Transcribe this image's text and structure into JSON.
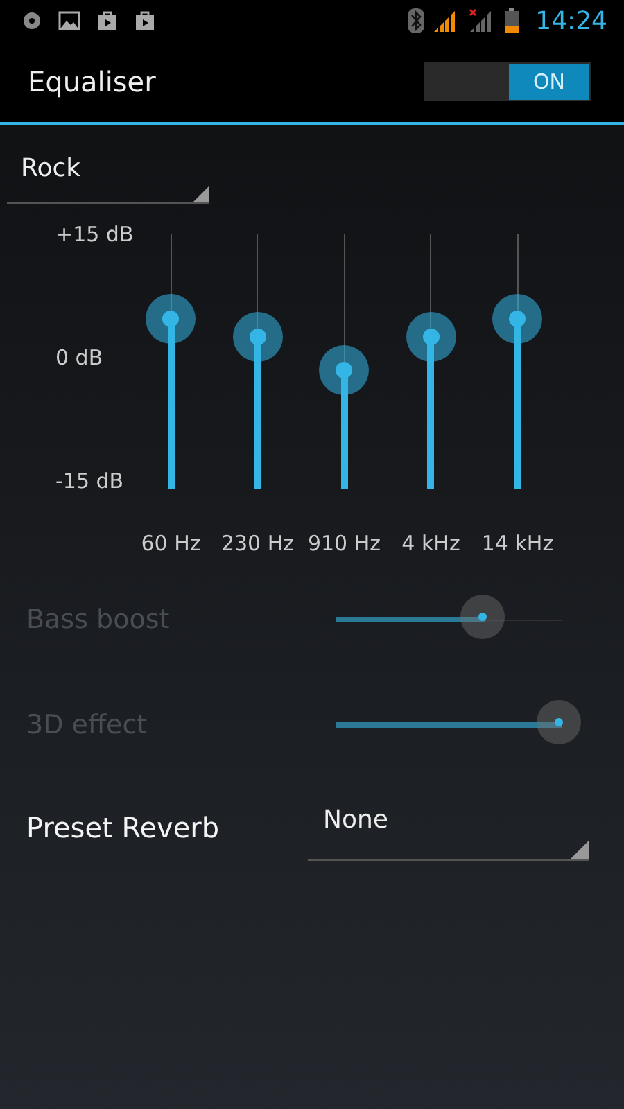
{
  "status_bar": {
    "time": "14:24"
  },
  "action_bar": {
    "title": "Equaliser",
    "switch": {
      "label": "ON",
      "on": true
    }
  },
  "preset": {
    "value": "Rock"
  },
  "equalizer": {
    "scale": [
      "+15 dB",
      "0 dB",
      "-15 dB"
    ],
    "bands": [
      {
        "label": "60 Hz",
        "level": 0.67
      },
      {
        "label": "230 Hz",
        "level": 0.6
      },
      {
        "label": "910 Hz",
        "level": 0.47
      },
      {
        "label": "4 kHz",
        "level": 0.6
      },
      {
        "label": "14 kHz",
        "level": 0.67
      }
    ]
  },
  "effects": [
    {
      "label": "Bass boost",
      "disabled": true,
      "level": 0.66
    },
    {
      "label": "3D effect",
      "disabled": true,
      "level": 1.0
    }
  ],
  "reverb": {
    "label": "Preset Reverb",
    "value": "None"
  }
}
